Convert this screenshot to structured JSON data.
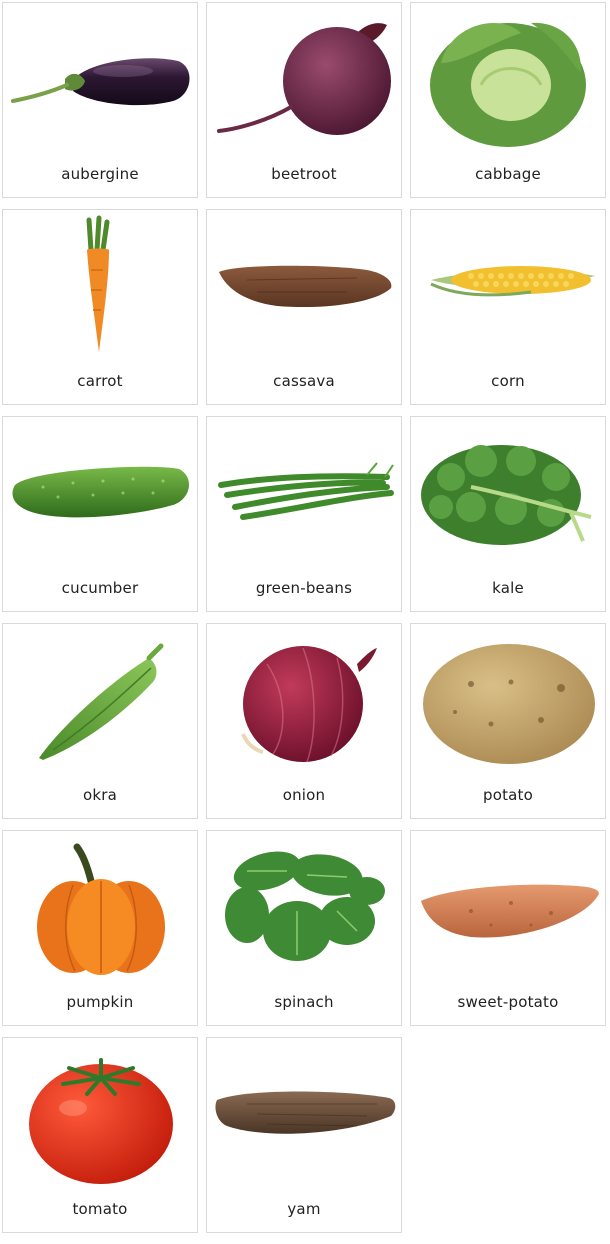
{
  "cards": [
    {
      "label": "aubergine",
      "icon": "aubergine-icon"
    },
    {
      "label": "beetroot",
      "icon": "beetroot-icon"
    },
    {
      "label": "cabbage",
      "icon": "cabbage-icon"
    },
    {
      "label": "carrot",
      "icon": "carrot-icon"
    },
    {
      "label": "cassava",
      "icon": "cassava-icon"
    },
    {
      "label": "corn",
      "icon": "corn-icon"
    },
    {
      "label": "cucumber",
      "icon": "cucumber-icon"
    },
    {
      "label": "green-beans",
      "icon": "green-beans-icon"
    },
    {
      "label": "kale",
      "icon": "kale-icon"
    },
    {
      "label": "okra",
      "icon": "okra-icon"
    },
    {
      "label": "onion",
      "icon": "onion-icon"
    },
    {
      "label": "potato",
      "icon": "potato-icon"
    },
    {
      "label": "pumpkin",
      "icon": "pumpkin-icon"
    },
    {
      "label": "spinach",
      "icon": "spinach-icon"
    },
    {
      "label": "sweet-potato",
      "icon": "sweet-potato-icon"
    },
    {
      "label": "tomato",
      "icon": "tomato-icon"
    },
    {
      "label": "yam",
      "icon": "yam-icon"
    }
  ]
}
